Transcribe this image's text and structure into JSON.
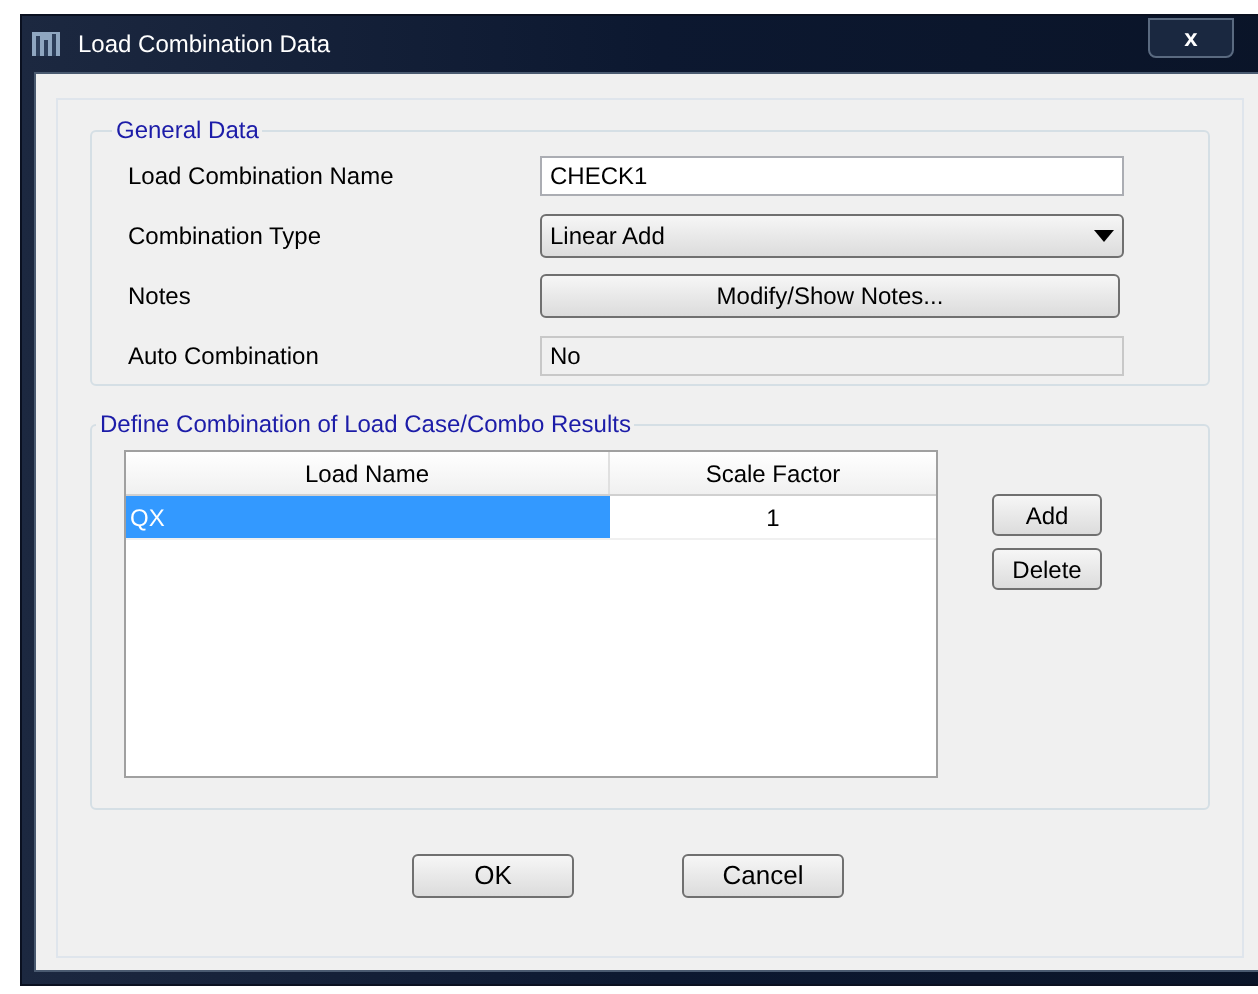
{
  "window": {
    "title": "Load Combination Data",
    "close": "x"
  },
  "general_data": {
    "title": "General Data",
    "fields": [
      {
        "kind": "text",
        "label": "Load Combination Name",
        "value": "CHECK1"
      },
      {
        "kind": "dropdown",
        "label": "Combination Type",
        "value": "Linear Add"
      },
      {
        "kind": "button",
        "label": "Notes",
        "value": "Modify/Show Notes..."
      },
      {
        "kind": "readonly",
        "label": "Auto Combination",
        "value": "No"
      }
    ]
  },
  "combination": {
    "title": "Define Combination of Load Case/Combo Results",
    "table": {
      "columns": [
        "Load Name",
        "Scale Factor"
      ],
      "rows": [
        {
          "cells": [
            "QX",
            "1"
          ],
          "selected": true
        }
      ]
    },
    "buttons": [
      "Add",
      "Delete"
    ]
  },
  "buttons": [
    "OK",
    "Cancel"
  ]
}
